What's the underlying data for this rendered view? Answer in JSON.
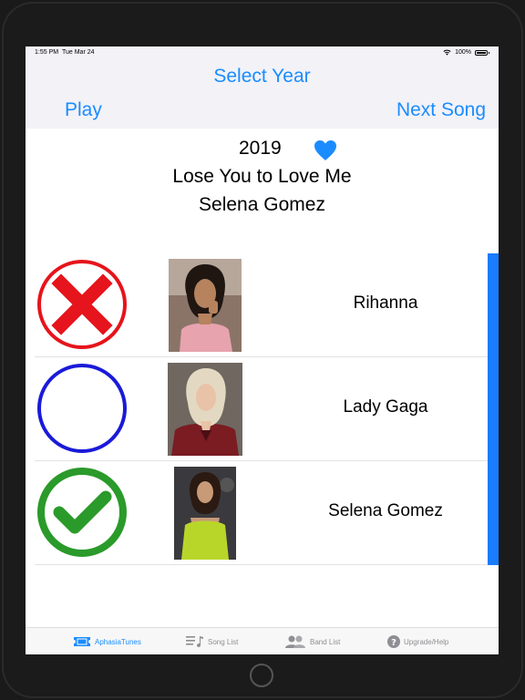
{
  "status_bar": {
    "time": "1:55 PM",
    "date": "Tue Mar 24",
    "battery": "100%",
    "battery_level": 1.0
  },
  "nav": {
    "title": "Select Year",
    "left_button": "Play",
    "right_button": "Next Song"
  },
  "song": {
    "year": "2019",
    "title": "Lose You to Love Me",
    "artist": "Selena Gomez",
    "favorite": true
  },
  "choices": [
    {
      "artist": "Rihanna",
      "state": "wrong",
      "mark_icon": "red-x-circle-icon"
    },
    {
      "artist": "Lady Gaga",
      "state": "unselected",
      "mark_icon": "empty-blue-circle-icon"
    },
    {
      "artist": "Selena Gomez",
      "state": "correct",
      "mark_icon": "green-check-circle-icon"
    }
  ],
  "tabs": [
    {
      "label": "AphasiaTunes",
      "icon": "ticket-icon",
      "active": true
    },
    {
      "label": "Song List",
      "icon": "music-list-icon",
      "active": false
    },
    {
      "label": "Band List",
      "icon": "people-icon",
      "active": false
    },
    {
      "label": "Upgrade/Help",
      "icon": "question-circle-icon",
      "active": false
    }
  ],
  "colors": {
    "accent": "#1a8cff",
    "wrong": "#e6141c",
    "neutral": "#1a1ad9",
    "correct": "#2a9a2a",
    "scroll": "#1a7cff"
  }
}
